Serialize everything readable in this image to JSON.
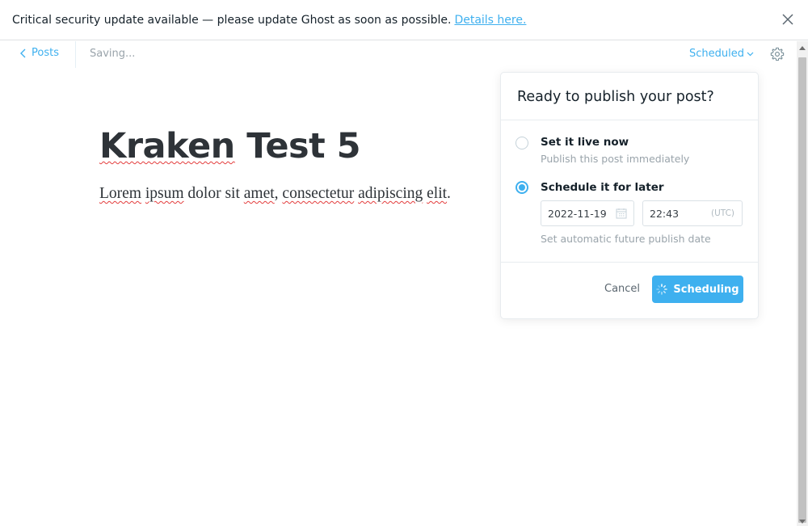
{
  "notification": {
    "text": "Critical security update available — please update Ghost as soon as possible.",
    "link": "Details here.",
    "close_icon": "close-icon"
  },
  "header": {
    "back_label": "Posts",
    "back_icon": "chevron-left-icon",
    "save_status": "Saving...",
    "post_status": "Scheduled",
    "dropdown_icon": "chevron-down-icon",
    "settings_icon": "gear-icon"
  },
  "post": {
    "title_part1": "Kraken",
    "title_part2": " Test 5",
    "body": {
      "w1": "Lorem",
      "s1": " ",
      "w2": "ipsum",
      "s2": " dolor sit ",
      "w3": "amet",
      "s3": ", ",
      "w4": "consectetur",
      "s4": " ",
      "w5": "adipiscing",
      "s5": " ",
      "w6": "elit",
      "s6": "."
    }
  },
  "publish_menu": {
    "title": "Ready to publish your post?",
    "option_now": {
      "label": "Set it live now",
      "description": "Publish this post immediately",
      "selected": false
    },
    "option_schedule": {
      "label": "Schedule it for later",
      "selected": true,
      "date": "2022-11-19",
      "time": "22:43",
      "timezone": "(UTC)",
      "hint": "Set automatic future publish date"
    },
    "cancel_label": "Cancel",
    "submit_label": "Scheduling"
  },
  "colors": {
    "accent": "#3eb0ef",
    "text": "#15212a",
    "muted": "#9aa4ab"
  }
}
